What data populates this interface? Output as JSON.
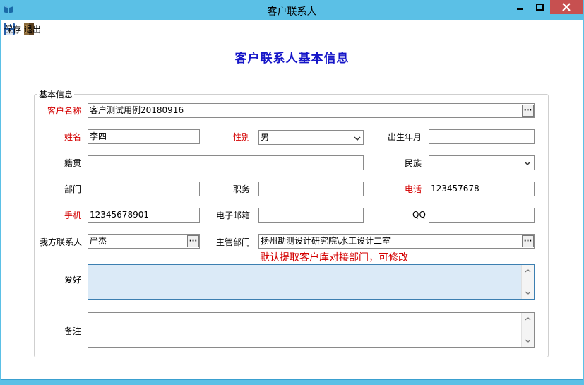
{
  "window": {
    "title": "客户联系人"
  },
  "toolbar": {
    "save_label": "保存",
    "exit_label": "退出"
  },
  "page": {
    "heading": "客户联系人基本信息"
  },
  "group": {
    "title": "基本信息"
  },
  "labels": {
    "customer_name": "客户名称",
    "name": "姓名",
    "gender": "性别",
    "birth": "出生年月",
    "native_place": "籍贯",
    "ethnicity": "民族",
    "department": "部门",
    "position": "职务",
    "phone": "电话",
    "mobile": "手机",
    "email": "电子邮箱",
    "qq": "QQ",
    "our_contact": "我方联系人",
    "manager_dept": "主管部门",
    "hobby": "爱好",
    "remark": "备注"
  },
  "values": {
    "customer_name": "客户测试用例20180916",
    "name": "李四",
    "gender": "男",
    "birth": "",
    "native_place": "",
    "ethnicity": "",
    "department": "",
    "position": "",
    "phone": "123457678",
    "mobile": "12345678901",
    "email": "",
    "qq": "",
    "our_contact": "严杰",
    "manager_dept": "扬州勘测设计研究院\\水工设计二室",
    "hobby": "",
    "remark": ""
  },
  "hint": "默认提取客户库对接部门，可修改",
  "icons": {
    "app": "book-icon",
    "save": "floppy-disk-icon",
    "exit": "exit-door-icon",
    "minimize": "minimize-icon",
    "maximize": "maximize-icon",
    "close": "close-icon"
  },
  "colors": {
    "title_bar": "#5bc0e6",
    "heading": "#1515c8",
    "required_label": "#d40000",
    "close_button": "#c75050"
  }
}
